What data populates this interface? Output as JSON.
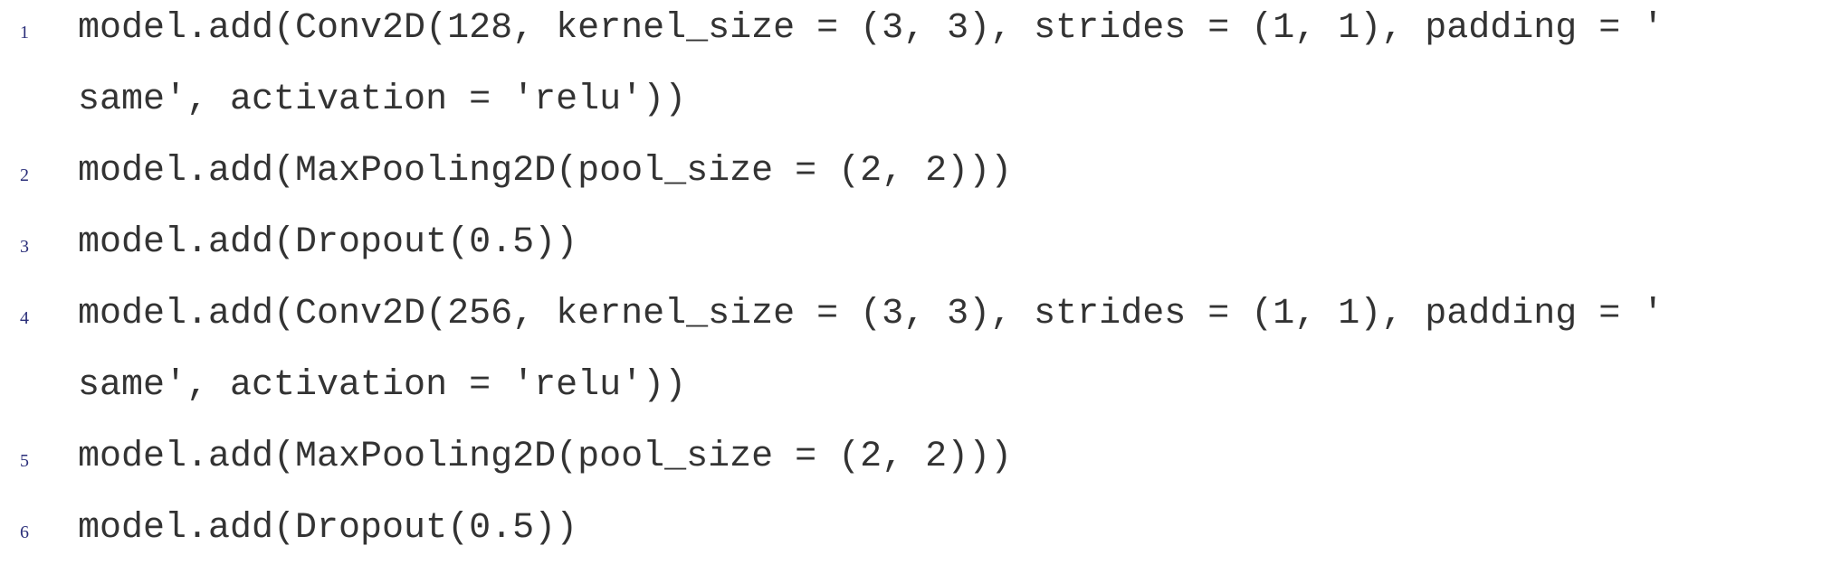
{
  "listing": {
    "lines": [
      {
        "number": "1",
        "text": "model.add(Conv2D(128, kernel_size = (3, 3), strides = (1, 1), padding = '"
      },
      {
        "number": "",
        "text": "same', activation = 'relu'))"
      },
      {
        "number": "2",
        "text": "model.add(MaxPooling2D(pool_size = (2, 2)))"
      },
      {
        "number": "3",
        "text": "model.add(Dropout(0.5))"
      },
      {
        "number": "4",
        "text": "model.add(Conv2D(256, kernel_size = (3, 3), strides = (1, 1), padding = '"
      },
      {
        "number": "",
        "text": "same', activation = 'relu'))"
      },
      {
        "number": "5",
        "text": "model.add(MaxPooling2D(pool_size = (2, 2)))"
      },
      {
        "number": "6",
        "text": "model.add(Dropout(0.5))"
      }
    ]
  },
  "colors": {
    "line_number": "#2b2f7a",
    "code_text": "#333333",
    "background": "#ffffff"
  }
}
